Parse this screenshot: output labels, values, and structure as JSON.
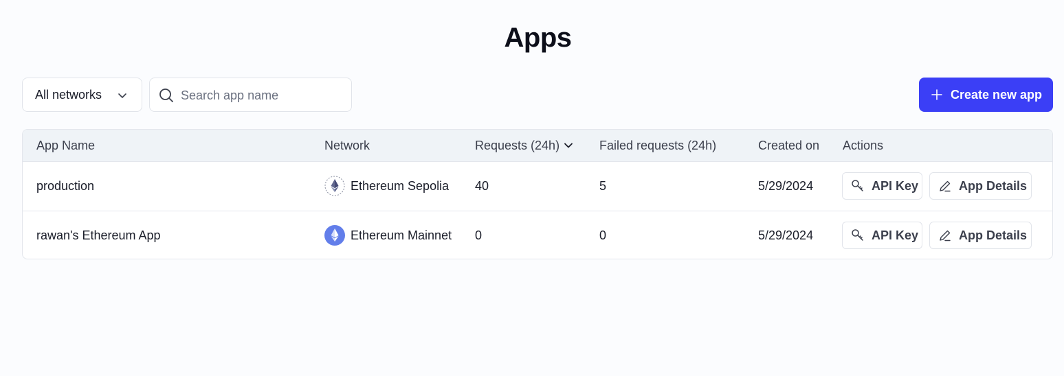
{
  "page": {
    "title": "Apps"
  },
  "toolbar": {
    "network_filter": "All networks",
    "search_placeholder": "Search app name",
    "create_label": "Create new app"
  },
  "colors": {
    "accent": "#3b3ff6",
    "header_bg": "#eff3f7"
  },
  "table": {
    "columns": [
      "App Name",
      "Network",
      "Requests (24h)",
      "Failed requests (24h)",
      "Created on",
      "Actions"
    ],
    "rows": [
      {
        "name": "production",
        "network": "Ethereum Sepolia",
        "network_icon": "ethereum-sepolia-icon",
        "requests": "40",
        "failed": "5",
        "created": "5/29/2024",
        "api_key_label": "API Key",
        "details_label": "App Details"
      },
      {
        "name": "rawan's Ethereum App",
        "network": "Ethereum Mainnet",
        "network_icon": "ethereum-mainnet-icon",
        "requests": "0",
        "failed": "0",
        "created": "5/29/2024",
        "api_key_label": "API Key",
        "details_label": "App Details"
      }
    ]
  }
}
